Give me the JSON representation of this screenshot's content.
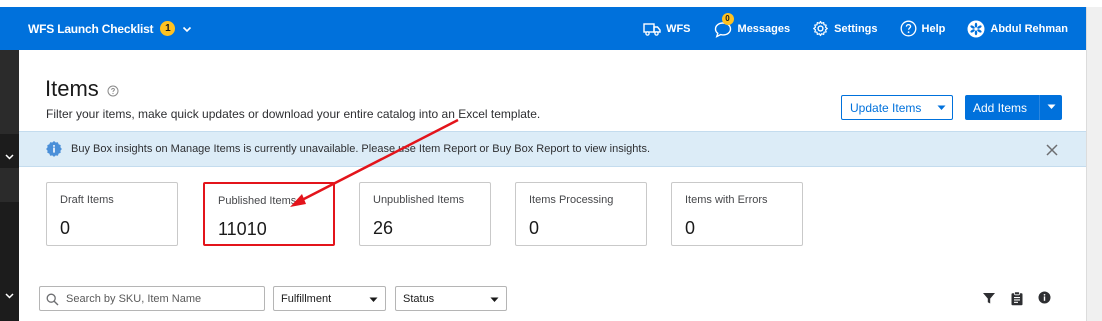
{
  "topbar": {
    "checklist_label": "WFS Launch Checklist",
    "checklist_badge": "1",
    "nav": {
      "wfs": "WFS",
      "messages": "Messages",
      "messages_badge": "0",
      "settings": "Settings",
      "help": "Help",
      "user": "Abdul Rehman"
    }
  },
  "page": {
    "title": "Items",
    "subtitle": "Filter your items, make quick updates or download your entire catalog into an Excel template.",
    "update_button": "Update Items",
    "add_button": "Add Items"
  },
  "banner": {
    "text": "Buy Box insights on Manage Items is currently unavailable. Please use Item Report or Buy Box Report to view insights."
  },
  "cards": [
    {
      "label": "Draft Items",
      "value": "0"
    },
    {
      "label": "Published Items",
      "value": "11010"
    },
    {
      "label": "Unpublished Items",
      "value": "26"
    },
    {
      "label": "Items Processing",
      "value": "0"
    },
    {
      "label": "Items with Errors",
      "value": "0"
    }
  ],
  "filters": {
    "search_placeholder": "Search by SKU, Item Name",
    "fulfillment": "Fulfillment",
    "status": "Status"
  },
  "colors": {
    "brand_blue": "#0071dc",
    "badge_yellow": "#ffc220",
    "banner_bg": "#dcecf7",
    "highlight_red": "#e3141b"
  },
  "icons": [
    "chevron-down-icon",
    "truck-icon",
    "message-bubble-icon",
    "gear-icon",
    "help-circle-icon",
    "avatar-icon",
    "info-icon",
    "close-icon",
    "search-icon",
    "filter-icon",
    "clipboard-icon",
    "arrow-annotation"
  ]
}
